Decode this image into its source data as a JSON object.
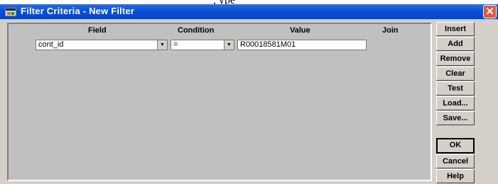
{
  "page": {
    "cut_text": ", ype"
  },
  "window": {
    "title": "Filter Criteria - New Filter",
    "close_glyph": "✕"
  },
  "grid": {
    "headers": {
      "field": "Field",
      "condition": "Condition",
      "value": "Value",
      "join": "Join"
    },
    "rows": [
      {
        "field": "cont_id",
        "condition": "=",
        "value": "R00018581M01",
        "join": ""
      }
    ],
    "dropdown_glyph": "▼"
  },
  "buttons": {
    "insert": "Insert",
    "add": "Add",
    "remove": "Remove",
    "clear": "Clear",
    "test": "Test",
    "load": "Load...",
    "save": "Save...",
    "ok": "OK",
    "cancel": "Cancel",
    "help": "Help"
  },
  "colors": {
    "titlebar": "#0a4fd4",
    "panel": "#c0c0c0",
    "dialog": "#d4d0c8",
    "close_button": "#e0573b"
  },
  "icons": {
    "title_icon": "app-window-icon",
    "close": "close-icon",
    "dropdown": "chevron-down-icon"
  }
}
